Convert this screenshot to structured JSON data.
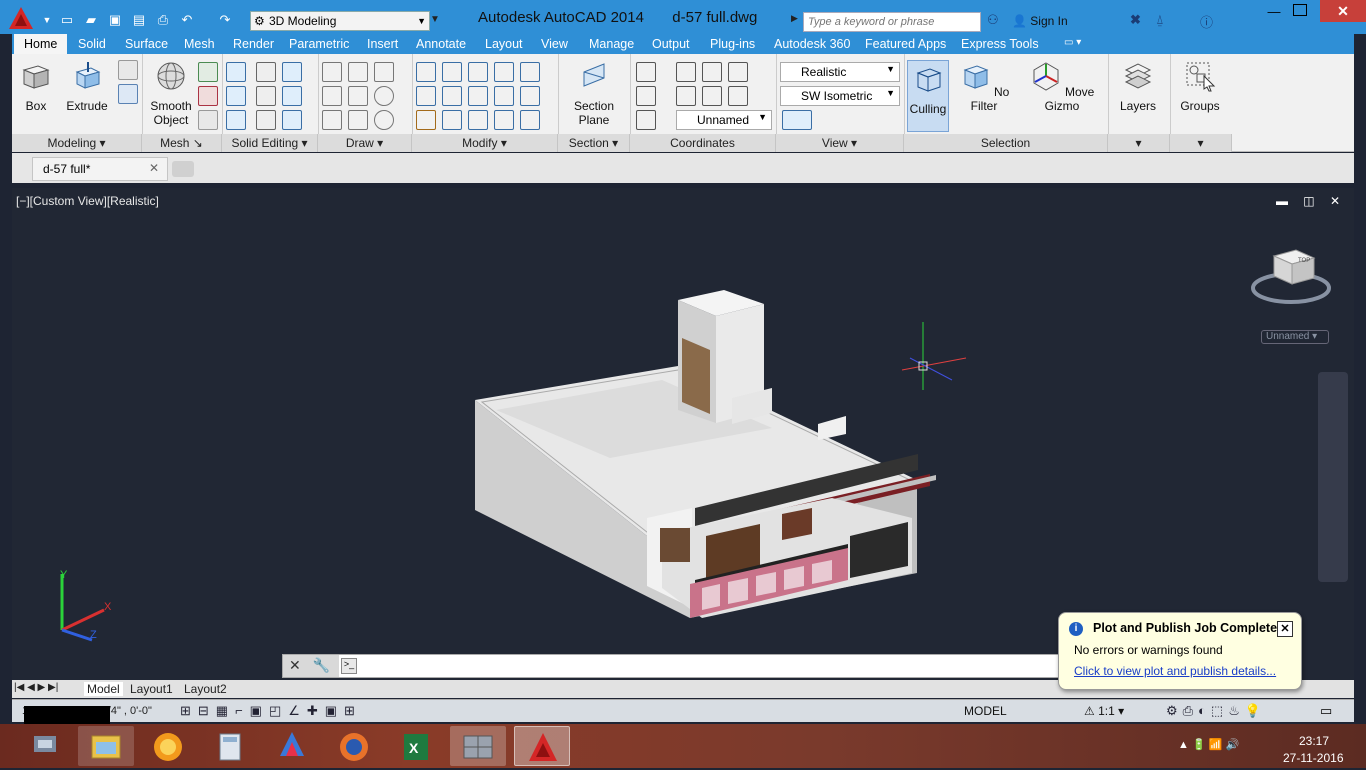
{
  "titlebar": {
    "workspace": "3D Modeling",
    "app_title": "Autodesk AutoCAD 2014",
    "file_title": "d-57 full.dwg",
    "search_placeholder": "Type a keyword or phrase",
    "sign_in": "Sign In"
  },
  "menu_tabs": [
    "Home",
    "Solid",
    "Surface",
    "Mesh",
    "Render",
    "Parametric",
    "Insert",
    "Annotate",
    "Layout",
    "View",
    "Manage",
    "Output",
    "Plug-ins",
    "Autodesk 360",
    "Featured Apps",
    "Express Tools"
  ],
  "ribbon": {
    "box": "Box",
    "extrude": "Extrude",
    "smooth_object_1": "Smooth",
    "smooth_object_2": "Object",
    "section_plane_1": "Section",
    "section_plane_2": "Plane",
    "visual_style": "Realistic",
    "view_preset": "SW Isometric",
    "ucs_name": "Unnamed",
    "culling": "Culling",
    "no_filter": "No Filter",
    "move_gizmo": "Move Gizmo",
    "layers": "Layers",
    "groups": "Groups",
    "panels": {
      "modeling": "Modeling",
      "mesh": "Mesh",
      "solid_editing": "Solid Editing",
      "draw": "Draw",
      "modify": "Modify",
      "section": "Section",
      "coordinates": "Coordinates",
      "view": "View",
      "selection": "Selection"
    }
  },
  "file_tab": "d-57 full*",
  "viewport": {
    "label": "[−][Custom View][Realistic]",
    "named_view": "Unnamed",
    "viewcube_face": "TOP"
  },
  "layout_tabs": [
    "Model",
    "Layout1",
    "Layout2"
  ],
  "statusbar": {
    "coords": "143'-8 1/4\", 1'-4 1/4\" , 0'-0\"",
    "model": "MODEL",
    "scale": "1:1"
  },
  "notification": {
    "title": "Plot and Publish Job Complete",
    "message": "No errors or warnings found",
    "link": "Click to view plot and publish details..."
  },
  "clock": {
    "time": "23:17",
    "date": "27-11-2016"
  }
}
